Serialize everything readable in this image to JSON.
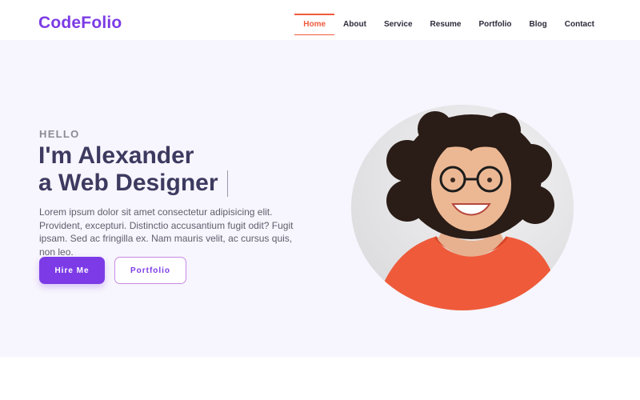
{
  "brand": {
    "logo": "CodeFolio",
    "accent": "#7c3be6",
    "nav_active": "#ef5a3d"
  },
  "nav": {
    "items": [
      {
        "label": "Home",
        "active": true
      },
      {
        "label": "About",
        "active": false
      },
      {
        "label": "Service",
        "active": false
      },
      {
        "label": "Resume",
        "active": false
      },
      {
        "label": "Portfolio",
        "active": false
      },
      {
        "label": "Blog",
        "active": false
      },
      {
        "label": "Contact",
        "active": false
      }
    ]
  },
  "hero": {
    "eyebrow": "HELLO",
    "greeting": "I'm",
    "name": "Alexander",
    "article": "a",
    "role": "Web Designer",
    "description": "Lorem ipsum dolor sit amet consectetur adipisicing elit. Provident, excepturi. Distinctio accusantium fugit odit? Fugit ipsam. Sed ac fringilla ex. Nam mauris velit, ac cursus quis, non leo.",
    "primary_button": "Hire Me",
    "secondary_button": "Portfolio",
    "background": "#f7f5fd"
  },
  "portrait": {
    "icon": "person-photo"
  }
}
